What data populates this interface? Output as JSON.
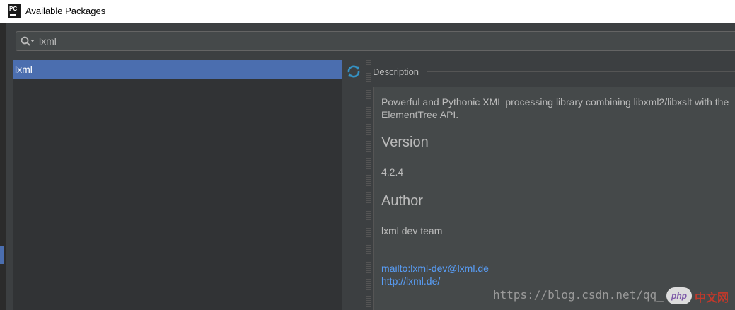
{
  "window": {
    "title": "Available Packages",
    "app_icon_label": "PC"
  },
  "search": {
    "value": "lxml",
    "placeholder": ""
  },
  "packages": [
    {
      "name": "lxml",
      "selected": true
    }
  ],
  "details": {
    "section_label": "Description",
    "description": "Powerful and Pythonic XML processing library combining libxml2/libxslt with the ElementTree API.",
    "version_heading": "Version",
    "version": "4.2.4",
    "author_heading": "Author",
    "author": "lxml dev team",
    "mailto_link": "mailto:lxml-dev@lxml.de",
    "homepage_link": "http://lxml.de/"
  },
  "watermark": {
    "url": "https://blog.csdn.net/qq_",
    "badge": "php",
    "cn": "中文网"
  },
  "colors": {
    "selection": "#4b6eaf",
    "link": "#589df6",
    "background": "#3c3f41",
    "refresh": "#3592c4"
  }
}
